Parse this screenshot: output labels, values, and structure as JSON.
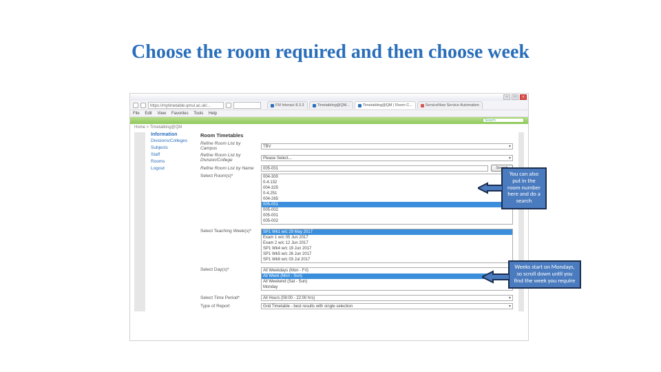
{
  "slide": {
    "title": "Choose the room required and then choose week"
  },
  "browser": {
    "window_buttons": {
      "min": "–",
      "max": "□",
      "close": "×"
    },
    "url": "https://mytimetable.qmul.ac.uk/...",
    "tabs": [
      {
        "label": "FM Interact 8.3.3"
      },
      {
        "label": "Timetabling@QM..."
      },
      {
        "label": "Timetabling@QM | Room C...",
        "active": true
      },
      {
        "label": "ServiceNow Service Automation"
      }
    ],
    "menu": [
      "File",
      "Edit",
      "View",
      "Favorites",
      "Tools",
      "Help"
    ],
    "header_search": "Search",
    "breadcrumb": "Home  > Timetabling@QM"
  },
  "sidebar": {
    "heading": "Information",
    "items": [
      "Divisions/Colleges",
      "Subjects",
      "Staff",
      "Rooms",
      "Logout"
    ]
  },
  "form": {
    "heading": "Room Timetables",
    "campus": {
      "label": "Refine Room List by Campus",
      "value": "TBV"
    },
    "division": {
      "label": "Refine Room List by Division/College",
      "value": "Please Select..."
    },
    "name": {
      "label": "Refine Room List by Name",
      "value": "005-001",
      "button": "Search"
    },
    "rooms": {
      "label": "Select Room(s)*",
      "options": [
        "004-300",
        "0-4.132",
        "004-325",
        "0-4.251",
        "004-265",
        "005-001",
        "005-002",
        "005-001",
        "005-002"
      ],
      "selected": 5
    },
    "weeks": {
      "label": "Select Teaching Week(s)*",
      "options": [
        "SP1 Wk1 w/c 29 May 2017",
        "Exam 1 w/c 05 Jun 2017",
        "Exam 2 w/c 12 Jun 2017",
        "SP1 Wk4 w/c 19 Jun 2017",
        "SP1 Wk5 w/c 26 Jun 2017",
        "SP1 Wk6 w/c 03 Jul 2017"
      ],
      "selected": 0
    },
    "days": {
      "label": "Select Day(s)*",
      "options": [
        "All Weekdays (Mon - Fri)",
        "All Week (Mon - Sun)",
        "All Weekend (Sat - Sun)",
        "Monday"
      ],
      "selected": 1
    },
    "time": {
      "label": "Select Time Period*",
      "value": "All Hours (08:00 - 22:00 hrs)"
    },
    "report": {
      "label": "Type of Report",
      "value": "Grid Timetable - best results with single selection"
    }
  },
  "callouts": {
    "c1": "You can also put in the room number here and do a search",
    "c2": "Weeks start on Mondays, so scroll down until you find the week you require"
  }
}
